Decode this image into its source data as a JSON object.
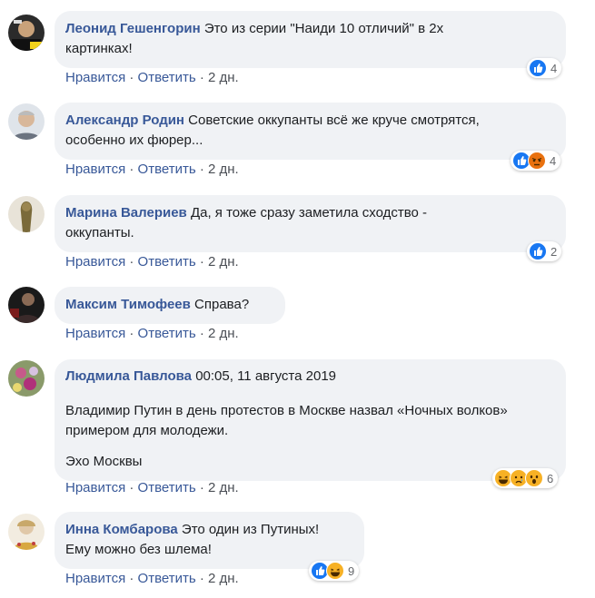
{
  "comments": [
    {
      "author": "Леонид Гешенгорин",
      "lines": [
        "Это из серии \"Наиди 10 отличий\" в 2х",
        "картинках!"
      ],
      "like": "Нравится",
      "reply": "Ответить",
      "time": "2 дн.",
      "reactions": [
        "like-icon"
      ],
      "count": "4"
    },
    {
      "author": "Александр Родин",
      "lines": [
        "Советские оккупанты всё же круче смотрятся,",
        "особенно их фюрер..."
      ],
      "like": "Нравится",
      "reply": "Ответить",
      "time": "2 дн.",
      "reactions": [
        "like-icon",
        "angry-icon"
      ],
      "count": "4"
    },
    {
      "author": "Марина Валериев",
      "lines": [
        "Да, я тоже сразу заметила сходство -",
        "оккупанты."
      ],
      "like": "Нравится",
      "reply": "Ответить",
      "time": "2 дн.",
      "reactions": [
        "like-icon"
      ],
      "count": "2"
    },
    {
      "author": "Максим Тимофеев",
      "lines": [
        "Справа?"
      ],
      "like": "Нравится",
      "reply": "Ответить",
      "time": "2 дн.",
      "reactions": [],
      "count": ""
    },
    {
      "author": "Людмила Павлова",
      "timestamp": "00:05, 11 августа 2019",
      "para1": "Владимир Путин в день протестов в Москве назвал «Ночных волков» примером для молодежи.",
      "para2": "Эхо Москвы",
      "like": "Нравится",
      "reply": "Ответить",
      "time": "2 дн.",
      "reactions": [
        "haha-icon",
        "sad-icon",
        "wow-icon"
      ],
      "count": "6"
    },
    {
      "author": "Инна Комбарова",
      "lines": [
        "Это один из Путиных!",
        "Ему можно без шлема!"
      ],
      "like": "Нравится",
      "reply": "Ответить",
      "time": "2 дн.",
      "reactions": [
        "like-icon",
        "haha-icon"
      ],
      "count": "9"
    }
  ],
  "separator": "·",
  "colors": {
    "link": "#385898",
    "bubble": "#f0f2f5",
    "like": "#1877f2",
    "angry": "#e9710f",
    "haha": "#f7b125"
  }
}
